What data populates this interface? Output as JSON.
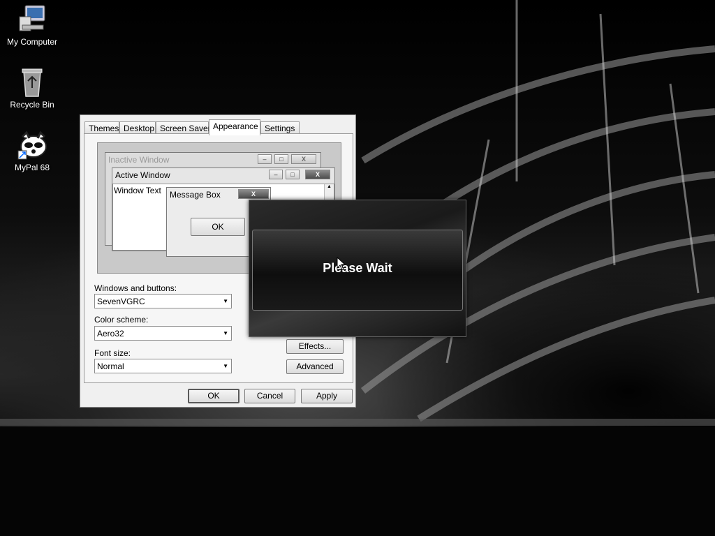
{
  "desktop": {
    "icons": [
      {
        "label": "My Computer",
        "icon": "computer-icon"
      },
      {
        "label": "Recycle Bin",
        "icon": "recycle-bin-icon"
      },
      {
        "label": "MyPal 68",
        "icon": "mypal-icon"
      }
    ]
  },
  "dialog": {
    "tabs": [
      "Themes",
      "Desktop",
      "Screen Saver",
      "Appearance",
      "Settings"
    ],
    "active_tab": "Appearance",
    "preview": {
      "inactive_title": "Inactive Window",
      "active_title": "Active Window",
      "window_text": "Window Text",
      "message_title": "Message Box",
      "message_ok": "OK",
      "close_glyph": "X"
    },
    "windows_buttons_label": "Windows and buttons:",
    "windows_buttons_value": "SevenVGRC",
    "color_scheme_label": "Color scheme:",
    "color_scheme_value": "Aero32",
    "font_size_label": "Font size:",
    "font_size_value": "Normal",
    "effects_button": "Effects...",
    "advanced_button": "Advanced",
    "ok_button": "OK",
    "cancel_button": "Cancel",
    "apply_button": "Apply"
  },
  "wait_box": {
    "message": "Please Wait"
  }
}
